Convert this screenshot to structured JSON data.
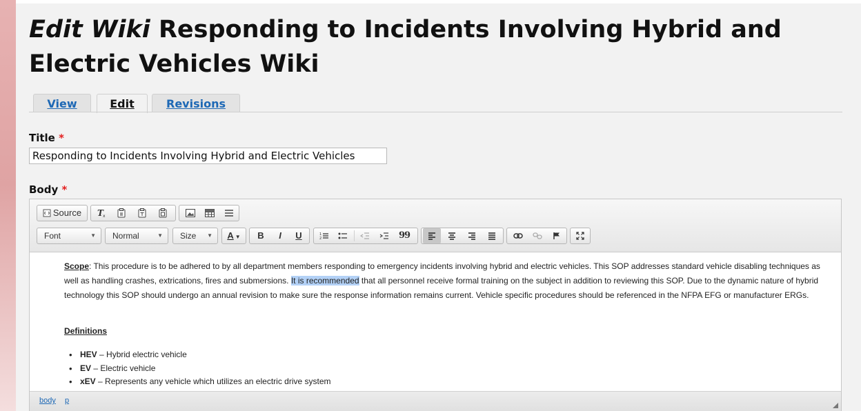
{
  "header": {
    "title_prefix": "Edit Wiki",
    "title_rest": " Responding to Incidents Involving Hybrid and Electric Vehicles Wiki"
  },
  "tabs": [
    {
      "label": "View",
      "active": false
    },
    {
      "label": "Edit",
      "active": true
    },
    {
      "label": "Revisions",
      "active": false
    }
  ],
  "form": {
    "title_label": "Title",
    "required_mark": "*",
    "title_value": "Responding to Incidents Involving Hybrid and Electric Vehicles",
    "body_label": "Body"
  },
  "toolbar": {
    "source_label": "Source",
    "font_label": "Font",
    "format_label": "Normal",
    "size_label": "Size",
    "bold_label": "B",
    "italic_label": "I",
    "underline_label": "U",
    "font_color_label": "A",
    "blockquote_label": "99",
    "icons": [
      "source-icon",
      "remove-format-icon",
      "paste-icon",
      "paste-text-icon",
      "paste-word-icon",
      "image-icon",
      "table-icon",
      "horizontal-rule-icon",
      "numbered-list-icon",
      "bulleted-list-icon",
      "outdent-icon",
      "indent-icon",
      "blockquote-icon",
      "align-left-icon",
      "align-center-icon",
      "align-right-icon",
      "justify-icon",
      "link-icon",
      "unlink-icon",
      "anchor-icon",
      "maximize-icon"
    ]
  },
  "content": {
    "scope_label": "Scope",
    "scope_text_before": ": This procedure is to be adhered to by all department members responding to emergency incidents involving hybrid and electric vehicles.  This SOP addresses standard vehicle disabling techniques as well as handling crashes, extrications, fires and submersions.  ",
    "selected_text": "It is recommended",
    "scope_text_after": " that all personnel receive formal training on the subject in addition to reviewing this SOP. Due to the dynamic nature of hybrid technology this SOP should undergo an annual revision to make sure the response information remains current.  Vehicle specific procedures should be referenced in the NFPA EFG or manufacturer ERGs.",
    "definitions_heading": "Definitions",
    "definitions": [
      {
        "term": "HEV",
        "desc": " – Hybrid electric vehicle"
      },
      {
        "term": "EV",
        "desc": " – Electric vehicle"
      },
      {
        "term": "xEV",
        "desc": " – Represents any vehicle which utilizes an electric drive system"
      }
    ]
  },
  "statusbar": {
    "path": [
      "body",
      "p"
    ]
  },
  "colors": {
    "accent_link": "#1d68b5",
    "required": "#e31f1f",
    "selection": "#b3d1f6"
  }
}
